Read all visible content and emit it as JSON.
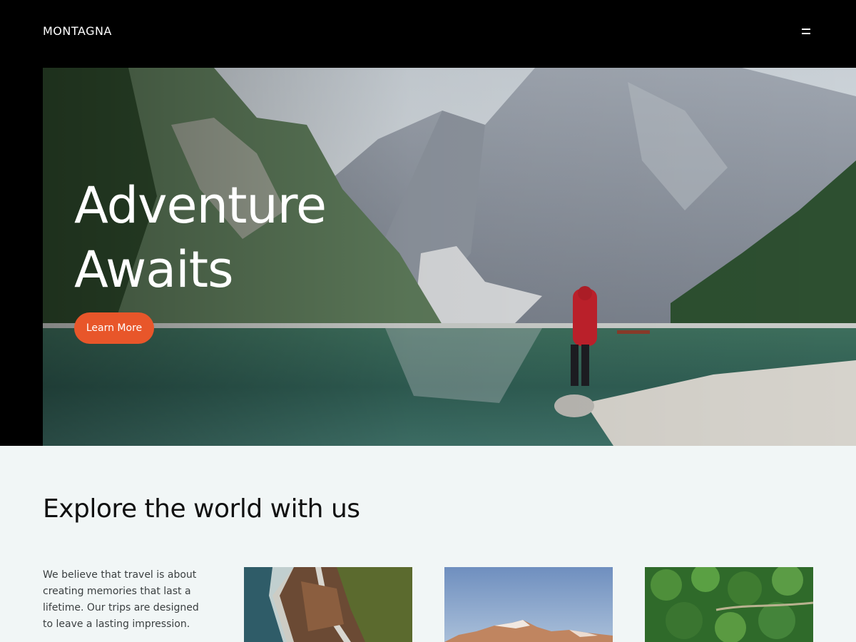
{
  "header": {
    "logo": "MONTAGNA",
    "menu_icon": "hamburger-menu-icon"
  },
  "hero": {
    "title_line1": "Adventure",
    "title_line2": "Awaits",
    "cta_label": "Learn More"
  },
  "explore": {
    "title": "Explore the world with us",
    "body": "We believe that travel is about creating memories that last a lifetime. Our trips are designed to leave a lasting impression.",
    "cards": [
      {
        "image": "coastal-road-aerial-photo"
      },
      {
        "image": "mountain-peaks-photo"
      },
      {
        "image": "palm-forest-aerial-photo"
      }
    ]
  },
  "colors": {
    "header_bg": "#000000",
    "accent": "#e8562a",
    "section_bg": "#f1f6f6",
    "text_dark": "#111111"
  }
}
